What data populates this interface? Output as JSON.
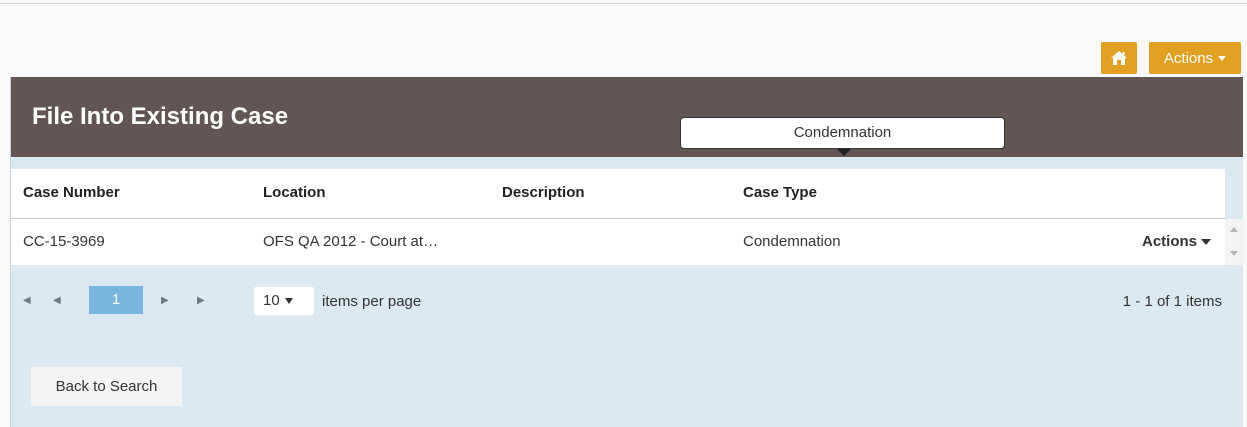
{
  "topbar": {
    "home_icon": "home-icon",
    "actions_label": "Actions"
  },
  "panel": {
    "title": "File Into Existing Case"
  },
  "grid": {
    "columns": [
      "Case Number",
      "Location",
      "Description",
      "Case Type"
    ],
    "rows": [
      {
        "case_number": "CC-15-3969",
        "location": "OFS QA 2012 - Court at…",
        "description": "",
        "case_type": "Condemnation",
        "actions_label": "Actions"
      }
    ],
    "tooltip": "Condemnation"
  },
  "pager": {
    "first_icon": "first-page-icon",
    "prev_icon": "prev-page-icon",
    "current_page": "1",
    "next_icon": "next-page-icon",
    "last_icon": "last-page-icon",
    "page_size": "10",
    "per_page_label": "items per page",
    "info": "1 - 1 of 1 items"
  },
  "back_button_label": "Back to Search",
  "colors": {
    "accent": "#e1a020",
    "header_bg": "#625553",
    "panel_bg": "#dbe9f3",
    "page_active": "#78b6de"
  }
}
